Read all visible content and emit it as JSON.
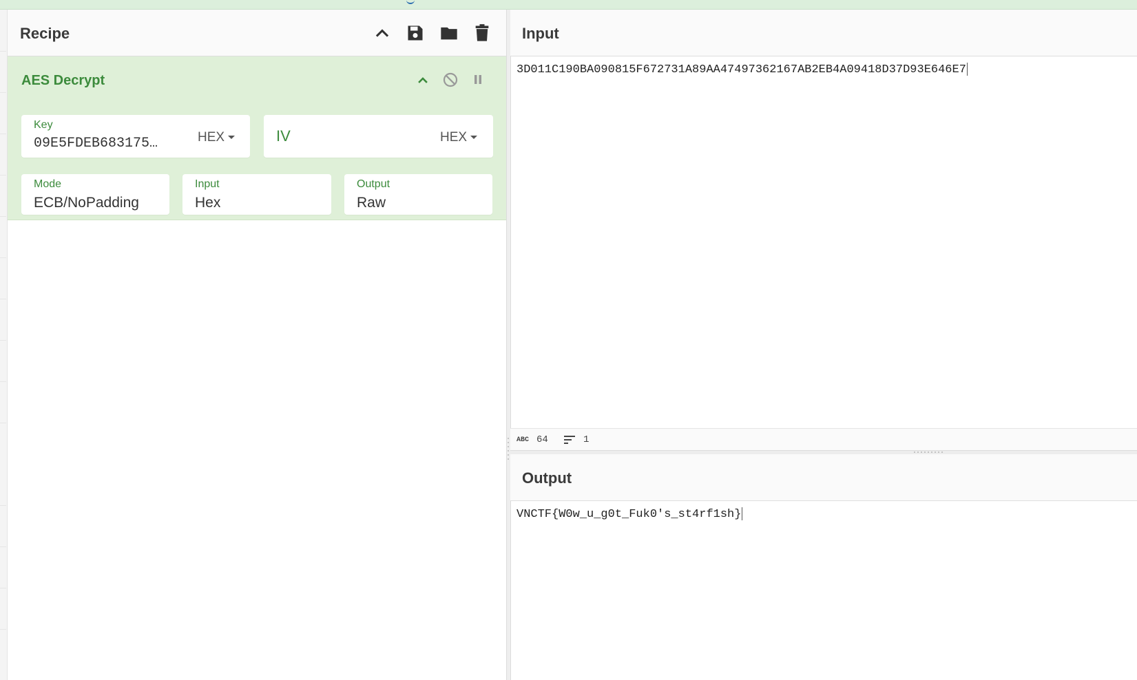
{
  "recipe": {
    "title": "Recipe",
    "buttons": [
      "collapse",
      "save",
      "load",
      "clear"
    ]
  },
  "operation": {
    "title": "AES Decrypt",
    "key": {
      "label": "Key",
      "value": "09E5FDEB683175…",
      "encoding": "HEX"
    },
    "iv": {
      "label": "IV",
      "value": "",
      "encoding": "HEX"
    },
    "mode": {
      "label": "Mode",
      "value": "ECB/NoPadding"
    },
    "input": {
      "label": "Input",
      "value": "Hex"
    },
    "output": {
      "label": "Output",
      "value": "Raw"
    }
  },
  "input_panel": {
    "title": "Input",
    "text": "3D011C190BA090815F672731A89AA47497362167AB2EB4A09418D37D93E646E7",
    "status": {
      "length": "64",
      "lines": "1"
    }
  },
  "output_panel": {
    "title": "Output",
    "text": "VNCTF{W0w_u_g0t_Fuk0's_st4rf1sh}"
  },
  "colors": {
    "accent_green": "#3c8b3c",
    "op_background": "#dff0d8"
  },
  "icons": {
    "collapse": "chevron-up-icon",
    "save": "save-icon",
    "load": "folder-icon",
    "clear": "trash-icon",
    "disable": "disable-icon",
    "breakpoint": "pause-icon"
  }
}
